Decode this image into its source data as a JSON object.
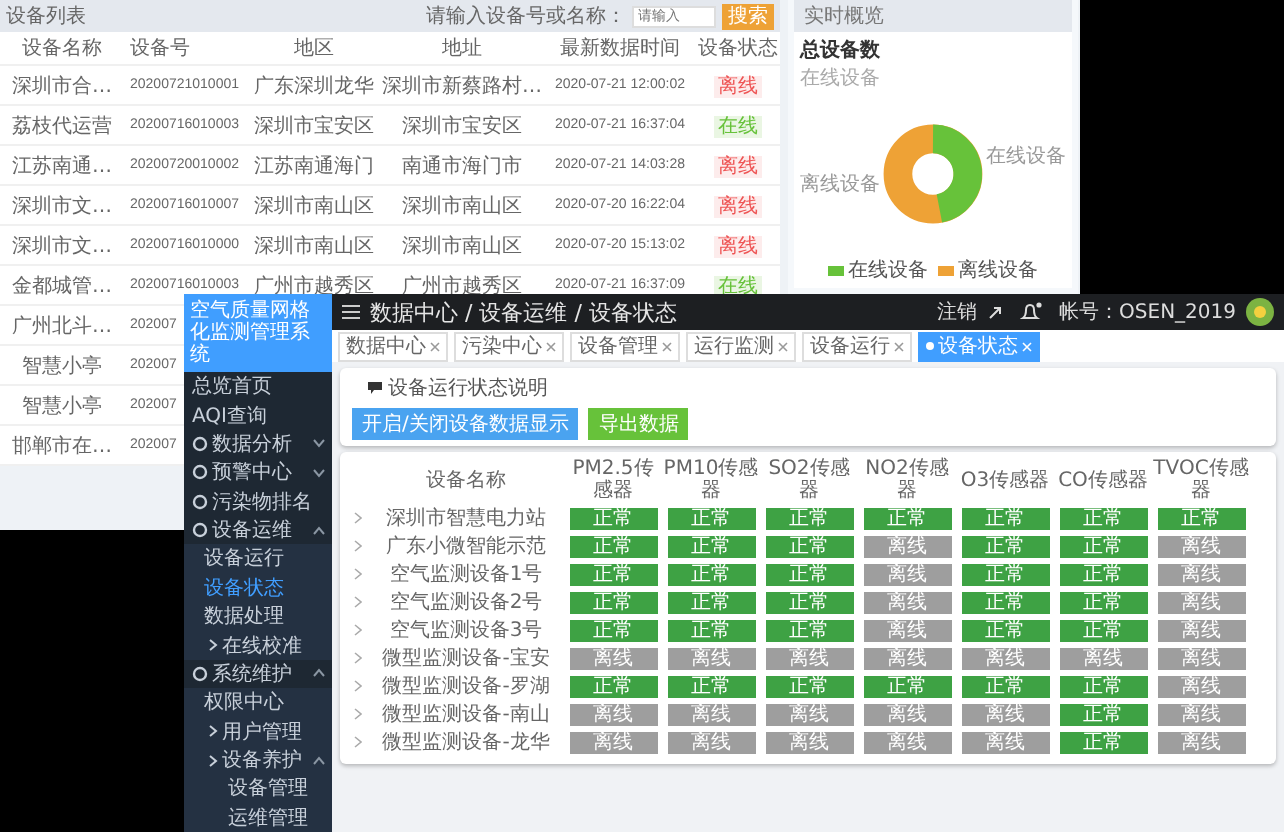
{
  "back_window": {
    "device_list": {
      "title": "设备列表",
      "search_label": "请输入设备号或名称：",
      "search": {
        "placeholder": "请输入"
      },
      "search_button": "搜索",
      "columns": [
        "设备名称",
        "设备号",
        "地区",
        "地址",
        "最新数据时间",
        "设备状态"
      ],
      "rows": [
        {
          "name": "深圳市合…",
          "number": "20200721010001",
          "region": "广东深圳龙华",
          "address": "深圳市新蔡路村…",
          "time": "2020-07-21 12:00:02",
          "status": "离线",
          "online": false
        },
        {
          "name": "荔枝代运营",
          "number": "20200716010003",
          "region": "深圳市宝安区",
          "address": "深圳市宝安区",
          "time": "2020-07-21 16:37:04",
          "status": "在线",
          "online": true
        },
        {
          "name": "江苏南通…",
          "number": "20200720010002",
          "region": "江苏南通海门",
          "address": "南通市海门市",
          "time": "2020-07-21 14:03:28",
          "status": "离线",
          "online": false
        },
        {
          "name": "深圳市文…",
          "number": "20200716010007",
          "region": "深圳市南山区",
          "address": "深圳市南山区",
          "time": "2020-07-20 16:22:04",
          "status": "离线",
          "online": false
        },
        {
          "name": "深圳市文…",
          "number": "20200716010000",
          "region": "深圳市南山区",
          "address": "深圳市南山区",
          "time": "2020-07-20 15:13:02",
          "status": "离线",
          "online": false
        },
        {
          "name": "金都城管…",
          "number": "20200716010003",
          "region": "广州市越秀区",
          "address": "广州市越秀区",
          "time": "2020-07-21 16:37:09",
          "status": "在线",
          "online": true
        },
        {
          "name": "广州北斗…",
          "number": "202007"
        },
        {
          "name": "智慧小亭",
          "number": "202007"
        },
        {
          "name": "智慧小亭",
          "number": "202007"
        },
        {
          "name": "邯郸市在…",
          "number": "202007"
        }
      ]
    },
    "overview": {
      "header": "实时概览",
      "title": "总设备数",
      "subtitle": "在线设备",
      "label_right": "在线设备",
      "label_left": "离线设备",
      "legend": [
        {
          "label": "在线设备",
          "color": "#67c23a"
        },
        {
          "label": "离线设备",
          "color": "#eea236"
        }
      ]
    }
  },
  "front_window": {
    "sidebar": {
      "title": "空气质量网格化监测管理系统",
      "items": [
        {
          "label": "总览首页",
          "kind": "link",
          "selected": false
        },
        {
          "label": "AQI查询",
          "kind": "link",
          "selected": false
        },
        {
          "label": "数据分析",
          "kind": "group",
          "expanded": false,
          "selected": false
        },
        {
          "label": "预警中心",
          "kind": "group",
          "expanded": false,
          "selected": false
        },
        {
          "label": "污染物排名",
          "kind": "group",
          "selected": false
        },
        {
          "label": "设备运维",
          "kind": "group",
          "expanded": true,
          "selected": false,
          "children": [
            {
              "label": "设备运行",
              "selected": false
            },
            {
              "label": "设备状态",
              "selected": true
            },
            {
              "label": "数据处理",
              "selected": false,
              "children": [
                {
                  "label": "在线校准",
                  "selected": false
                }
              ]
            }
          ]
        },
        {
          "label": "系统维护",
          "kind": "group",
          "expanded": true,
          "selected": false,
          "children": [
            {
              "label": "权限中心",
              "selected": false,
              "children": [
                {
                  "label": "用户管理",
                  "selected": false
                },
                {
                  "label": "设备养护",
                  "expanded": true,
                  "selected": false,
                  "children": [
                    {
                      "label": "设备管理",
                      "selected": false
                    },
                    {
                      "label": "运维管理",
                      "selected": false
                    }
                  ]
                }
              ]
            }
          ]
        }
      ]
    },
    "header": {
      "breadcrumb": "数据中心 / 设备运维 / 设备状态",
      "logout": "注销",
      "account": "帐号：OSEN_2019"
    },
    "tabs": [
      {
        "label": "数据中心",
        "selected": false
      },
      {
        "label": "污染中心",
        "selected": false
      },
      {
        "label": "设备管理",
        "selected": false
      },
      {
        "label": "运行监测",
        "selected": false
      },
      {
        "label": "设备运行",
        "selected": false
      },
      {
        "label": "设备状态",
        "selected": true
      }
    ],
    "panel": {
      "note": "设备运行状态说明",
      "buttons": [
        {
          "label": "开启/关闭设备数据显示",
          "kind": "primary"
        },
        {
          "label": "导出数据",
          "kind": "success"
        }
      ]
    },
    "table": {
      "columns": [
        "设备名称",
        "PM2.5传感器",
        "PM10传感器",
        "SO2传感器",
        "NO2传感器",
        "O3传感器",
        "CO传感器",
        "TVOC传感器"
      ],
      "rows": [
        {
          "name": "深圳市智慧电力站",
          "sensors": [
            {
              "text": "正常",
              "online": true
            },
            {
              "text": "正常",
              "online": true
            },
            {
              "text": "正常",
              "online": true
            },
            {
              "text": "正常",
              "online": true
            },
            {
              "text": "正常",
              "online": true
            },
            {
              "text": "正常",
              "online": true
            },
            {
              "text": "正常",
              "online": true
            }
          ]
        },
        {
          "name": "广东小微智能示范",
          "sensors": [
            {
              "text": "正常",
              "online": true
            },
            {
              "text": "正常",
              "online": true
            },
            {
              "text": "正常",
              "online": true
            },
            {
              "text": "离线",
              "online": false
            },
            {
              "text": "正常",
              "online": true
            },
            {
              "text": "正常",
              "online": true
            },
            {
              "text": "离线",
              "online": false
            }
          ]
        },
        {
          "name": "空气监测设备1号",
          "sensors": [
            {
              "text": "正常",
              "online": true
            },
            {
              "text": "正常",
              "online": true
            },
            {
              "text": "正常",
              "online": true
            },
            {
              "text": "离线",
              "online": false
            },
            {
              "text": "正常",
              "online": true
            },
            {
              "text": "正常",
              "online": true
            },
            {
              "text": "离线",
              "online": false
            }
          ]
        },
        {
          "name": "空气监测设备2号",
          "sensors": [
            {
              "text": "正常",
              "online": true
            },
            {
              "text": "正常",
              "online": true
            },
            {
              "text": "正常",
              "online": true
            },
            {
              "text": "离线",
              "online": false
            },
            {
              "text": "正常",
              "online": true
            },
            {
              "text": "正常",
              "online": true
            },
            {
              "text": "离线",
              "online": false
            }
          ]
        },
        {
          "name": "空气监测设备3号",
          "sensors": [
            {
              "text": "正常",
              "online": true
            },
            {
              "text": "正常",
              "online": true
            },
            {
              "text": "正常",
              "online": true
            },
            {
              "text": "离线",
              "online": false
            },
            {
              "text": "正常",
              "online": true
            },
            {
              "text": "正常",
              "online": true
            },
            {
              "text": "离线",
              "online": false
            }
          ]
        },
        {
          "name": "微型监测设备-宝安",
          "sensors": [
            {
              "text": "离线",
              "online": false
            },
            {
              "text": "离线",
              "online": false
            },
            {
              "text": "离线",
              "online": false
            },
            {
              "text": "离线",
              "online": false
            },
            {
              "text": "离线",
              "online": false
            },
            {
              "text": "离线",
              "online": false
            },
            {
              "text": "离线",
              "online": false
            }
          ]
        },
        {
          "name": "微型监测设备-罗湖",
          "sensors": [
            {
              "text": "正常",
              "online": true
            },
            {
              "text": "正常",
              "online": true
            },
            {
              "text": "正常",
              "online": true
            },
            {
              "text": "正常",
              "online": true
            },
            {
              "text": "正常",
              "online": true
            },
            {
              "text": "正常",
              "online": true
            },
            {
              "text": "离线",
              "online": false
            }
          ]
        },
        {
          "name": "微型监测设备-南山",
          "sensors": [
            {
              "text": "离线",
              "online": false
            },
            {
              "text": "离线",
              "online": false
            },
            {
              "text": "离线",
              "online": false
            },
            {
              "text": "离线",
              "online": false
            },
            {
              "text": "离线",
              "online": false
            },
            {
              "text": "正常",
              "online": true
            },
            {
              "text": "离线",
              "online": false
            }
          ]
        },
        {
          "name": "微型监测设备-龙华",
          "sensors": [
            {
              "text": "离线",
              "online": false
            },
            {
              "text": "离线",
              "online": false
            },
            {
              "text": "离线",
              "online": false
            },
            {
              "text": "离线",
              "online": false
            },
            {
              "text": "离线",
              "online": false
            },
            {
              "text": "正常",
              "online": true
            },
            {
              "text": "离线",
              "online": false
            }
          ]
        }
      ]
    }
  }
}
